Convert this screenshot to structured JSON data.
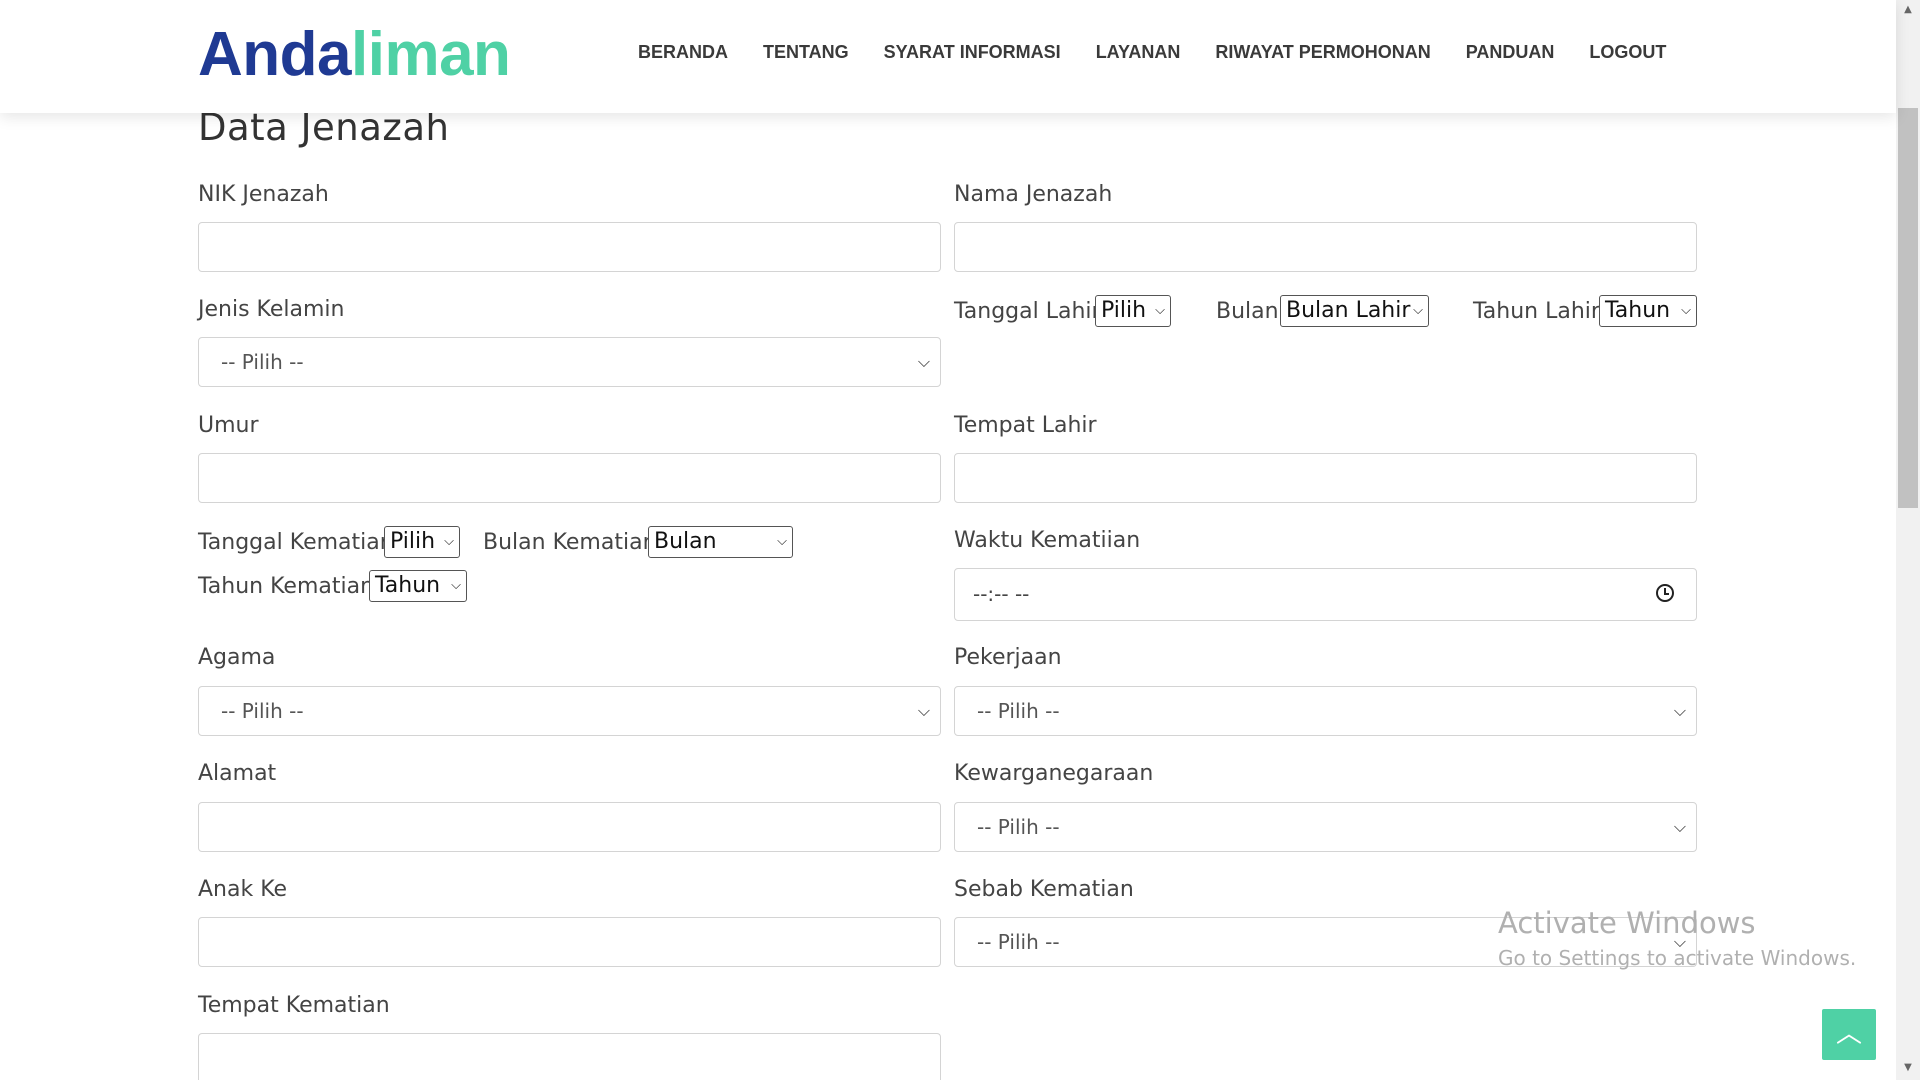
{
  "logo": {
    "part1": "Anda",
    "part2": "liman"
  },
  "nav": [
    "BERANDA",
    "TENTANG",
    "SYARAT INFORMASI",
    "LAYANAN",
    "RIWAYAT PERMOHONAN",
    "PANDUAN",
    "LOGOUT"
  ],
  "section_title": "Data Jenazah",
  "labels": {
    "nik": "NIK Jenazah",
    "nama": "Nama Jenazah",
    "jenis_kelamin": "Jenis Kelamin",
    "tanggal_lahir": "Tanggal Lahir",
    "bulan": "Bulan",
    "tahun_lahir": "Tahun Lahir",
    "umur": "Umur",
    "tempat_lahir": "Tempat Lahir",
    "tanggal_kematian": "Tanggal Kematian",
    "bulan_kematian": "Bulan Kematian",
    "tahun_kematian": "Tahun Kematian",
    "waktu_kematian": "Waktu Kematiian",
    "agama": "Agama",
    "pekerjaan": "Pekerjaan",
    "alamat": "Alamat",
    "kewarganegaraan": "Kewarganegaraan",
    "anak_ke": "Anak Ke",
    "sebab_kematian": "Sebab Kematian",
    "tempat_kematian": "Tempat Kematian"
  },
  "selects": {
    "jenis_kelamin": "-- Pilih --",
    "tanggal_lahir": "Pilih",
    "bulan_lahir": "Bulan Lahir",
    "tahun_lahir": "Tahun",
    "tanggal_kematian": "Pilih",
    "bulan_kematian": "Bulan",
    "tahun_kematian": "Tahun",
    "agama": "-- Pilih --",
    "pekerjaan": "-- Pilih --",
    "kewarganegaraan": "-- Pilih --",
    "sebab_kematian": "-- Pilih --"
  },
  "time_placeholder": "--:-- --",
  "watermark": {
    "line1": "Activate Windows",
    "line2": "Go to Settings to activate Windows."
  },
  "back_to_top": "^"
}
